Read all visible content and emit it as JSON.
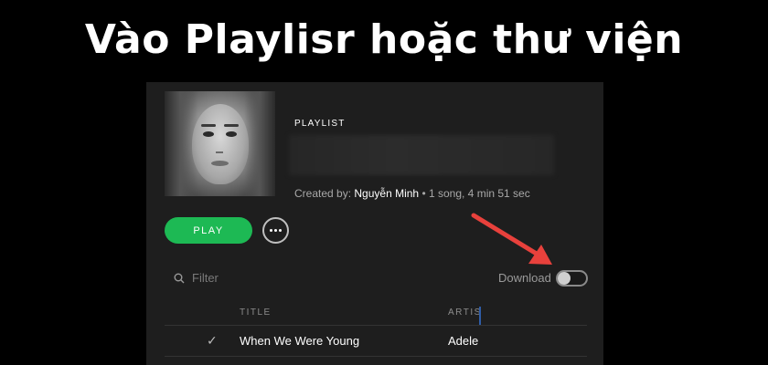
{
  "banner": {
    "title": "Vào Playlisr hoặc thư viện"
  },
  "playlist": {
    "type_label": "PLAYLIST",
    "created_by_prefix": "Created by:",
    "owner": "Nguyễn Minh",
    "stats": "• 1 song, 4 min 51 sec"
  },
  "actions": {
    "play_label": "PLAY"
  },
  "filter": {
    "placeholder": "Filter"
  },
  "download": {
    "label": "Download",
    "enabled": false
  },
  "table": {
    "columns": {
      "title": "TITLE",
      "artist": "ARTIST"
    },
    "rows": [
      {
        "title": "When We Were Young",
        "artist": "Adele",
        "saved": true
      }
    ]
  },
  "colors": {
    "accent": "#1db954",
    "annotation_arrow": "#e8413c",
    "background": "#1e1e1e"
  },
  "icons": [
    "more-options-icon",
    "search-icon",
    "check-icon",
    "arrow-annotation-icon"
  ]
}
